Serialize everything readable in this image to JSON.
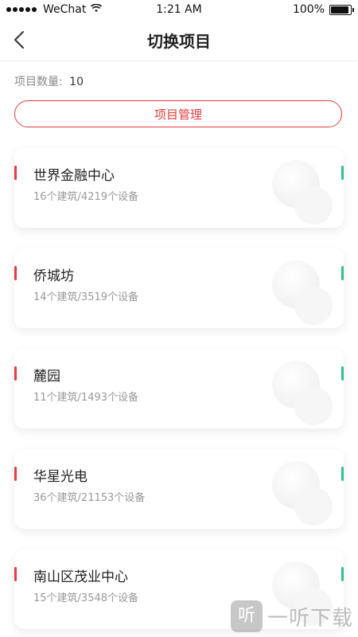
{
  "status_bar": {
    "carrier": "WeChat",
    "time": "1:21 AM",
    "battery": "100%",
    "battery_level": 1.0
  },
  "nav": {
    "title": "切换项目"
  },
  "summary": {
    "count_label": "项目数量:",
    "count_value": "10"
  },
  "manage_button_label": "项目管理",
  "projects": [
    {
      "name": "世界金融中心",
      "stats": "16个建筑/4219个设备"
    },
    {
      "name": "侨城坊",
      "stats": "14个建筑/3519个设备"
    },
    {
      "name": "麓园",
      "stats": "11个建筑/1493个设备"
    },
    {
      "name": "华星光电",
      "stats": "36个建筑/21153个设备"
    },
    {
      "name": "南山区茂业中心",
      "stats": "15个建筑/3548个设备"
    }
  ],
  "watermark": {
    "icon_glyph": "听",
    "text": "一听下载"
  },
  "colors": {
    "accent_red": "#e63b3b",
    "accent_green": "#2fc18c"
  }
}
